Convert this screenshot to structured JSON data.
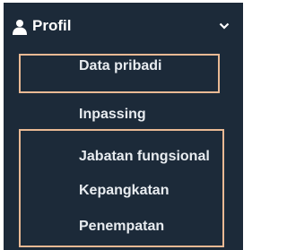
{
  "menu": {
    "header": {
      "icon": "user-icon",
      "label": "Profil",
      "toggle_icon": "chevron-down-icon"
    },
    "items": [
      {
        "label": "Data pribadi"
      },
      {
        "label": "Inpassing"
      },
      {
        "label": "Jabatan fungsional"
      },
      {
        "label": "Kepangkatan"
      },
      {
        "label": "Penempatan"
      }
    ]
  },
  "colors": {
    "background": "#1c2a39",
    "text": "#ffffff",
    "highlight": "#e9b994"
  }
}
